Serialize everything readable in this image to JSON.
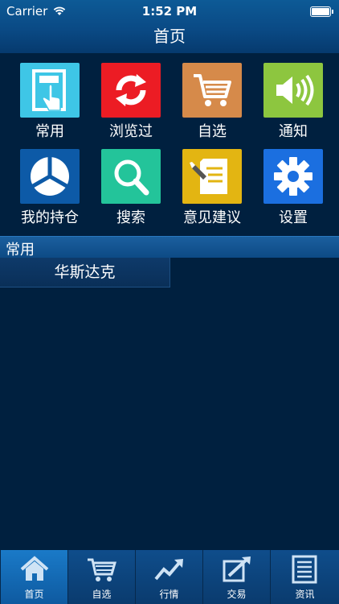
{
  "status": {
    "carrier": "Carrier",
    "time": "1:52 PM"
  },
  "header": {
    "title": "首页"
  },
  "grid": {
    "items": [
      {
        "label": "常用",
        "icon": "hand-click-icon",
        "color": "#3ec6e6"
      },
      {
        "label": "浏览过",
        "icon": "refresh-icon",
        "color": "#ec1c24"
      },
      {
        "label": "自选",
        "icon": "cart-icon",
        "color": "#d68a4a"
      },
      {
        "label": "通知",
        "icon": "speaker-icon",
        "color": "#8dc63f"
      },
      {
        "label": "我的持仓",
        "icon": "pie-chart-icon",
        "color": "#0d5aa7"
      },
      {
        "label": "搜索",
        "icon": "search-icon",
        "color": "#23c49a"
      },
      {
        "label": "意见建议",
        "icon": "note-edit-icon",
        "color": "#e3b512"
      },
      {
        "label": "设置",
        "icon": "gear-icon",
        "color": "#1b6fe0"
      }
    ]
  },
  "section": {
    "title": "常用"
  },
  "list": {
    "items": [
      {
        "label": "华斯达克"
      }
    ]
  },
  "tabbar": {
    "tabs": [
      {
        "label": "首页",
        "icon": "home-icon",
        "active": true
      },
      {
        "label": "自选",
        "icon": "cart-icon"
      },
      {
        "label": "行情",
        "icon": "trend-icon"
      },
      {
        "label": "交易",
        "icon": "trade-icon"
      },
      {
        "label": "资讯",
        "icon": "news-icon"
      }
    ]
  }
}
